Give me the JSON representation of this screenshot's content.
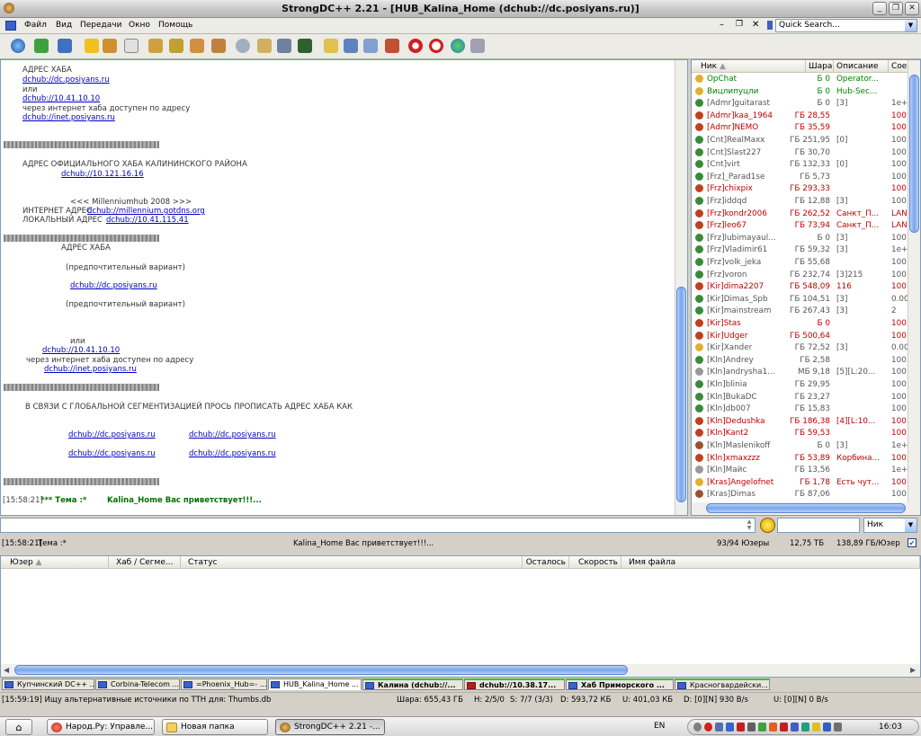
{
  "window": {
    "title": "StrongDC++ 2.21 - [HUB_Kalina_Home (dchub://dc.posiyans.ru)]"
  },
  "menu": {
    "items": [
      "Файл",
      "Вид",
      "Передачи",
      "Окно",
      "Помощь"
    ],
    "quick_search": "Quick Search..."
  },
  "chat": {
    "lines": [
      {
        "t": "АДРЕС ХАБА",
        "link": false
      },
      {
        "t": "dchub://dc.posiyans.ru",
        "link": true
      },
      {
        "t": "или",
        "link": false
      },
      {
        "t": "dchub://10.41.10.10",
        "link": true
      },
      {
        "t": "через интернет хаба доступен по адресу",
        "link": false
      },
      {
        "t": "dchub://inet.posiyans.ru",
        "link": true
      },
      {
        "t": "АДРЕС ОФИЦИАЛЬНОГО ХАБА КАЛИНИНСКОГО РАЙОНА",
        "link": false
      },
      {
        "t": "dchub://10.121.16.16",
        "link": true
      },
      {
        "t": "<<< Millenniumhub 2008 >>>",
        "link": false
      },
      {
        "t": "ИНТЕРНЕТ АДРЕС",
        "link": false
      },
      {
        "t": "dchub://millennium.gotdns.org",
        "link": true
      },
      {
        "t": "ЛОКАЛЬНЫЙ АДРЕС",
        "link": false
      },
      {
        "t": "dchub://10.41.115.41",
        "link": true
      },
      {
        "t": "АДРЕС ХАБА",
        "link": false
      },
      {
        "t": "(предпочтительный вариант)",
        "link": false
      },
      {
        "t": "dchub://dc.posiyans.ru",
        "link": true
      },
      {
        "t": "(предпочтительный вариант)",
        "link": false
      },
      {
        "t": "или",
        "link": false
      },
      {
        "t": "dchub://10.41.10.10",
        "link": true
      },
      {
        "t": "через интернет хаба доступен по адресу",
        "link": false
      },
      {
        "t": "dchub://inet.posiyans.ru",
        "link": true
      },
      {
        "t": "В СВЯЗИ С ГЛОБАЛЬНОЙ СЕГМЕНТИЗАЦИЕЙ ПРОСЬ ПРОПИСАТЬ АДРЕС ХАБА КАК",
        "link": false
      },
      {
        "t": "dchub://dc.posiyans.ru",
        "link": true
      },
      {
        "t": "dchub://dc.posiyans.ru",
        "link": true
      },
      {
        "t": "dchub://dc.posiyans.ru",
        "link": true
      },
      {
        "t": "dchub://dc.posiyans.ru",
        "link": true
      }
    ],
    "separator": "||||||||||||||||||||||||||||||||||||||||||||||||||||||||||||||||||||||||||||||||||||||||||||||||||||||||||||||||||||||||||||||||||||||",
    "last_time": "[15:58:21]",
    "last_topic": "*** Тема :*",
    "last_welcome": "Kalina_Home Вас приветствует!!!..."
  },
  "userlist": {
    "headers": [
      "Ник",
      "Шара",
      "Описание",
      "Сое"
    ],
    "users": [
      {
        "nick": "OpChat",
        "share": "0 Б",
        "desc": "Operator...",
        "conn": "",
        "color": "#008000",
        "icon": "#e0b030"
      },
      {
        "nick": "Вицлипуцли",
        "share": "0 Б",
        "desc": "Hub-Sec...",
        "conn": "",
        "color": "#008000",
        "icon": "#e0b030"
      },
      {
        "nick": "[Admr]guitarast",
        "share": "0 Б",
        "desc": "[3]",
        "conn": "1e+",
        "color": "#555",
        "icon": "#3a8a3a"
      },
      {
        "nick": "[Admr]kaa_1964",
        "share": "28,55 ГБ",
        "desc": "",
        "conn": "100",
        "color": "#c00000",
        "icon": "#c04020"
      },
      {
        "nick": "[Admr]NEMO",
        "share": "35,59 ГБ",
        "desc": "",
        "conn": "100",
        "color": "#c00000",
        "icon": "#c04020"
      },
      {
        "nick": "[Cnt]RealMaxx",
        "share": "251,95 ГБ",
        "desc": "[0]",
        "conn": "100",
        "color": "#555",
        "icon": "#3a8a3a"
      },
      {
        "nick": "[Cnt]Slast227",
        "share": "30,70 ГБ",
        "desc": "",
        "conn": "100",
        "color": "#555",
        "icon": "#3a8a3a"
      },
      {
        "nick": "[Cnt]virt",
        "share": "132,33 ГБ",
        "desc": "[0]",
        "conn": "100",
        "color": "#555",
        "icon": "#3a8a3a"
      },
      {
        "nick": "[Frz]_Parad1se",
        "share": "5,73 ГБ",
        "desc": "",
        "conn": "100",
        "color": "#555",
        "icon": "#3a8a3a"
      },
      {
        "nick": "[Frz]chixpix",
        "share": "293,33 ГБ",
        "desc": "",
        "conn": "100",
        "color": "#c00000",
        "icon": "#c04020"
      },
      {
        "nick": "[Frz]iddqd",
        "share": "12,88 ГБ",
        "desc": "[3]",
        "conn": "100",
        "color": "#555",
        "icon": "#3a8a3a"
      },
      {
        "nick": "[Frz]kondr2006",
        "share": "262,52 ГБ",
        "desc": "Санкт_П...",
        "conn": "LAN",
        "color": "#c00000",
        "icon": "#c04020"
      },
      {
        "nick": "[Frz]leo67",
        "share": "73,94 ГБ",
        "desc": "Санкт_П...",
        "conn": "LAN",
        "color": "#c00000",
        "icon": "#c04020"
      },
      {
        "nick": "[Frz]lubimayaul...",
        "share": "0 Б",
        "desc": "[3]",
        "conn": "100",
        "color": "#555",
        "icon": "#3a8a3a"
      },
      {
        "nick": "[Frz]Vladimir61",
        "share": "59,32 ГБ",
        "desc": "[3]",
        "conn": "1e+",
        "color": "#555",
        "icon": "#3a8a3a"
      },
      {
        "nick": "[Frz]volk_jeka",
        "share": "55,68 ГБ",
        "desc": "",
        "conn": "100",
        "color": "#555",
        "icon": "#3a8a3a"
      },
      {
        "nick": "[Frz]voron",
        "share": "232,74 ГБ",
        "desc": "[3]215",
        "conn": "100",
        "color": "#555",
        "icon": "#3a8a3a"
      },
      {
        "nick": "[Kir]dima2207",
        "share": "548,09 ГБ",
        "desc": "116",
        "conn": "100",
        "color": "#c00000",
        "icon": "#c04020"
      },
      {
        "nick": "[Kir]Dimas_Spb",
        "share": "104,51 ГБ",
        "desc": "[3]",
        "conn": "0.00",
        "color": "#555",
        "icon": "#3a8a3a"
      },
      {
        "nick": "[Kir]mainstream",
        "share": "267,43 ГБ",
        "desc": "[3]",
        "conn": "2",
        "color": "#555",
        "icon": "#3a8a3a"
      },
      {
        "nick": "[Kir]Stas",
        "share": "0 Б",
        "desc": "",
        "conn": "100",
        "color": "#c00000",
        "icon": "#c04020"
      },
      {
        "nick": "[Kir]Udger",
        "share": "500,64 ГБ",
        "desc": "",
        "conn": "100",
        "color": "#c00000",
        "icon": "#c04020"
      },
      {
        "nick": "[Kir]Xander",
        "share": "72,52 ГБ",
        "desc": "[3]",
        "conn": "0.00",
        "color": "#555",
        "icon": "#e0b030"
      },
      {
        "nick": "[Kln]Andrey",
        "share": "2,58 ГБ",
        "desc": "",
        "conn": "100",
        "color": "#555",
        "icon": "#3a8a3a"
      },
      {
        "nick": "[Kln]andrysha1...",
        "share": "9,18 МБ",
        "desc": "[5][L:20...",
        "conn": "100",
        "color": "#555",
        "icon": "#999999"
      },
      {
        "nick": "[Kln]blinia",
        "share": "29,95 ГБ",
        "desc": "",
        "conn": "100",
        "color": "#555",
        "icon": "#3a8a3a"
      },
      {
        "nick": "[Kln]BukaDC",
        "share": "23,27 ГБ",
        "desc": "",
        "conn": "100",
        "color": "#555",
        "icon": "#3a8a3a"
      },
      {
        "nick": "[Kln]db007",
        "share": "15,83 ГБ",
        "desc": "",
        "conn": "100",
        "color": "#555",
        "icon": "#3a8a3a"
      },
      {
        "nick": "[Kln]Dedushka",
        "share": "186,38 ГБ",
        "desc": "[4][L:10...",
        "conn": "100",
        "color": "#c00000",
        "icon": "#c04020"
      },
      {
        "nick": "[Kln]Kant2",
        "share": "59,53 ГБ",
        "desc": "",
        "conn": "100",
        "color": "#c00000",
        "icon": "#c04020"
      },
      {
        "nick": "[Kln]Maslenikoff",
        "share": "0 Б",
        "desc": "[3]",
        "conn": "1e+",
        "color": "#555",
        "icon": "#a05030"
      },
      {
        "nick": "[Kln]xmaxzzz",
        "share": "53,89 ГБ",
        "desc": "Корбина...",
        "conn": "100",
        "color": "#c00000",
        "icon": "#c04020"
      },
      {
        "nick": "[Kln]Майс",
        "share": "13,56 ГБ",
        "desc": "",
        "conn": "1e+",
        "color": "#555",
        "icon": "#999999"
      },
      {
        "nick": "[Kras]Angelofnet",
        "share": "1,78 ГБ",
        "desc": "Есть чут...",
        "conn": "100",
        "color": "#c00000",
        "icon": "#e0b030"
      },
      {
        "nick": "[Kras]Dimas",
        "share": "87,06 ГБ",
        "desc": "",
        "conn": "100",
        "color": "#555",
        "icon": "#a05030"
      }
    ]
  },
  "input": {
    "filter_select": "Ник"
  },
  "status1": {
    "time": "[15:58:21]",
    "topic": "Тема :*",
    "welcome": "Kalina_Home Вас приветствует!!!...",
    "users": "93/94 Юзеры",
    "share": "12,75 ТБ",
    "per_user": "138,89 ГБ/Юзер"
  },
  "transfers": {
    "headers": [
      "Юзер",
      "Хаб / Сегме...",
      "Статус",
      "Осталось",
      "Скорость",
      "Имя файла"
    ]
  },
  "tabs": [
    {
      "label": "Купчинский DC++ ...",
      "bold": false
    },
    {
      "label": "Corbina-Telecom ...",
      "bold": false
    },
    {
      "label": "=Phoenix_Hub=- ...",
      "bold": false
    },
    {
      "label": "HUB_Kalina_Home ...",
      "bold": false
    },
    {
      "label": "Калина (dchub://...",
      "bold": true
    },
    {
      "label": "dchub://10.38.17...",
      "bold": true
    },
    {
      "label": "Хаб Приморского ...",
      "bold": true
    },
    {
      "label": "Красногвардейски...",
      "bold": false
    }
  ],
  "status2": {
    "msg": "[15:59:19] Ищу альтернативные источники по TTH для: Thumbs.db",
    "share": "Шара: 655,43 ГБ",
    "hubs": "H: 2/5/0",
    "slots": "S: 7/7 (3/3)",
    "down": "D: 593,72 КБ",
    "up": "U: 401,03 КБ",
    "dspeed": "D: [0][N] 930 B/s",
    "uspeed": "U: [0][N] 0 B/s"
  },
  "taskbar": {
    "items": [
      "Народ.Ру: Управле...",
      "Новая папка",
      "StrongDC++ 2.21 -..."
    ],
    "lang": "EN",
    "clock": "16:03"
  }
}
